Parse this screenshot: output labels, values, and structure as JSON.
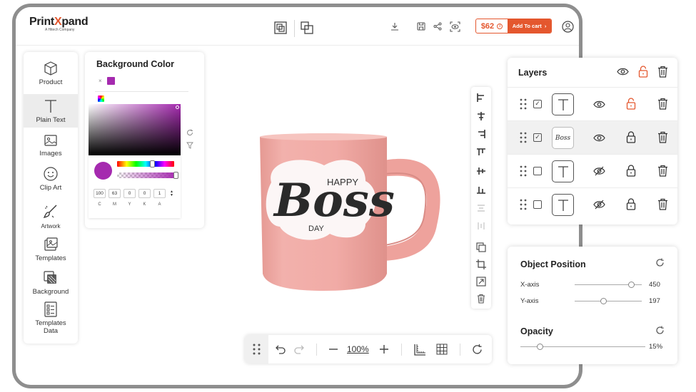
{
  "app": {
    "logo_main_a": "Print",
    "logo_main_x": "X",
    "logo_main_b": "pand",
    "logo_sub": "A Hitech Company"
  },
  "header": {
    "price": "$62",
    "price_info": "i",
    "add_to_cart": "Add To cart",
    "cart_chevron": "›"
  },
  "sidebar": {
    "items": [
      {
        "label": "Product",
        "icon": "cube-icon"
      },
      {
        "label": "Plain Text",
        "icon": "text-icon"
      },
      {
        "label": "Images",
        "icon": "image-icon"
      },
      {
        "label": "Clip Art",
        "icon": "smiley-icon"
      },
      {
        "label": "Artwork",
        "icon": "brush-icon"
      },
      {
        "label": "Templates",
        "icon": "templates-icon"
      },
      {
        "label": "Background",
        "icon": "background-icon"
      },
      {
        "label": "Templates Data",
        "icon": "list-icon"
      }
    ]
  },
  "background_panel": {
    "title": "Background Color",
    "clear": "×",
    "selected_color": "#a52aaf",
    "cmyk": [
      {
        "label": "C",
        "value": "100"
      },
      {
        "label": "M",
        "value": "63"
      },
      {
        "label": "Y",
        "value": "0"
      },
      {
        "label": "K",
        "value": "0"
      },
      {
        "label": "A",
        "value": "1"
      }
    ],
    "spin_up": "▲",
    "spin_down": "▼"
  },
  "canvas": {
    "mug_text_happy": "HAPPY",
    "mug_text_boss": "Boss",
    "mug_text_day": "DAY",
    "mug_color": "#f0a9a5"
  },
  "toolbar": {
    "zoom": "100%"
  },
  "layers": {
    "title": "Layers",
    "thumb_boss": "Boss",
    "rows": [
      {
        "checked": true,
        "thumb": "T",
        "visible": true,
        "locked": false
      },
      {
        "checked": true,
        "thumb": "boss",
        "visible": true,
        "locked": true
      },
      {
        "checked": false,
        "thumb": "T",
        "visible": false,
        "locked": true
      },
      {
        "checked": false,
        "thumb": "T",
        "visible": false,
        "locked": true
      }
    ],
    "check_mark": "✓"
  },
  "object_position": {
    "title": "Object Position",
    "x_label": "X-axis",
    "x_value": "450",
    "y_label": "Y-axis",
    "y_value": "197",
    "opacity_title": "Opacity",
    "opacity_value": "15%"
  },
  "colors": {
    "accent": "#e4572e",
    "frame": "#8e8e8e"
  }
}
